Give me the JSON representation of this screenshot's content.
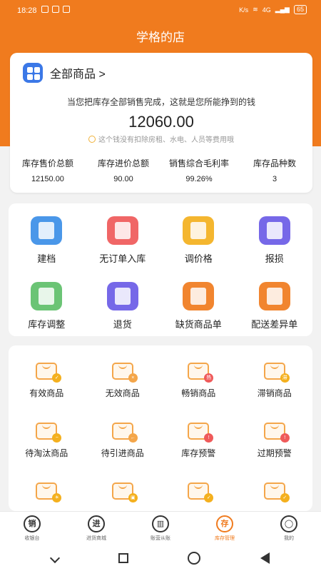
{
  "status": {
    "time": "18:28",
    "net": "K/s",
    "signal": "4G",
    "battery": "65"
  },
  "header": {
    "title": "学格的店"
  },
  "summary": {
    "all_goods_label": "全部商品 >",
    "tagline": "当您把库存全部销售完成，这就是您所能挣到的钱",
    "amount": "12060.00",
    "note": "这个钱没有扣除房租、水电、人员等费用哦",
    "stats": [
      {
        "label": "库存售价总额",
        "value": "12150.00"
      },
      {
        "label": "库存进价总额",
        "value": "90.00"
      },
      {
        "label": "销售综合毛利率",
        "value": "99.26%"
      },
      {
        "label": "库存品种数",
        "value": "3"
      }
    ]
  },
  "actions": [
    {
      "label": "建档",
      "icon": "folder-icon",
      "color": "#3b8fe8"
    },
    {
      "label": "无订单入库",
      "icon": "inbox-download-icon",
      "color": "#ef5a5a"
    },
    {
      "label": "调价格",
      "icon": "yen-adjust-icon",
      "color": "#f4b01e"
    },
    {
      "label": "报损",
      "icon": "clipboard-minus-icon",
      "color": "#6b5ce7"
    },
    {
      "label": "库存调整",
      "icon": "stock-adjust-icon",
      "color": "#5fbf6a"
    },
    {
      "label": "退货",
      "icon": "clipboard-return-icon",
      "color": "#6b5ce7"
    },
    {
      "label": "缺货商品单",
      "icon": "shortage-list-icon",
      "color": "#f07b1e"
    },
    {
      "label": "配送差异单",
      "icon": "delivery-diff-icon",
      "color": "#f07b1e"
    }
  ],
  "goods_categories": [
    {
      "label": "有效商品",
      "icon": "valid-goods-icon",
      "badge_color": "#f4b01e",
      "badge": "✓"
    },
    {
      "label": "无效商品",
      "icon": "invalid-goods-icon",
      "badge_color": "#f4a64a",
      "badge": "×"
    },
    {
      "label": "畅销商品",
      "icon": "hot-goods-icon",
      "badge_color": "#ef5a5a",
      "badge": "热"
    },
    {
      "label": "滞销商品",
      "icon": "slow-goods-icon",
      "badge_color": "#f4b01e",
      "badge": "滞"
    },
    {
      "label": "待淘汰商品",
      "icon": "to-eliminate-icon",
      "badge_color": "#f4b01e",
      "badge": "−"
    },
    {
      "label": "待引进商品",
      "icon": "to-introduce-icon",
      "badge_color": "#f4a64a",
      "badge": "←"
    },
    {
      "label": "库存预警",
      "icon": "stock-warning-icon",
      "badge_color": "#ef5a5a",
      "badge": "!"
    },
    {
      "label": "过期预警",
      "icon": "expiry-warning-icon",
      "badge_color": "#ef5a5a",
      "badge": "!"
    },
    {
      "label": "",
      "icon": "goods-icon",
      "badge_color": "#f4b01e",
      "badge": "☀"
    },
    {
      "label": "",
      "icon": "goods-icon",
      "badge_color": "#f4b01e",
      "badge": "▣"
    },
    {
      "label": "",
      "icon": "goods-icon",
      "badge_color": "#f4b01e",
      "badge": "✓"
    },
    {
      "label": "",
      "icon": "goods-icon",
      "badge_color": "#f4b01e",
      "badge": "✓"
    }
  ],
  "tabs": [
    {
      "label": "收银台",
      "glyph": "销",
      "icon": "sales-icon",
      "active": false
    },
    {
      "label": "进货商城",
      "glyph": "进",
      "icon": "purchase-icon",
      "active": false
    },
    {
      "label": "账营从账",
      "glyph": "▥",
      "icon": "report-icon",
      "active": false
    },
    {
      "label": "库存管理",
      "glyph": "存",
      "icon": "stock-icon",
      "active": true
    },
    {
      "label": "我的",
      "glyph": "◯",
      "icon": "profile-icon",
      "active": false
    }
  ],
  "theme": {
    "accent": "#f07b1e"
  }
}
